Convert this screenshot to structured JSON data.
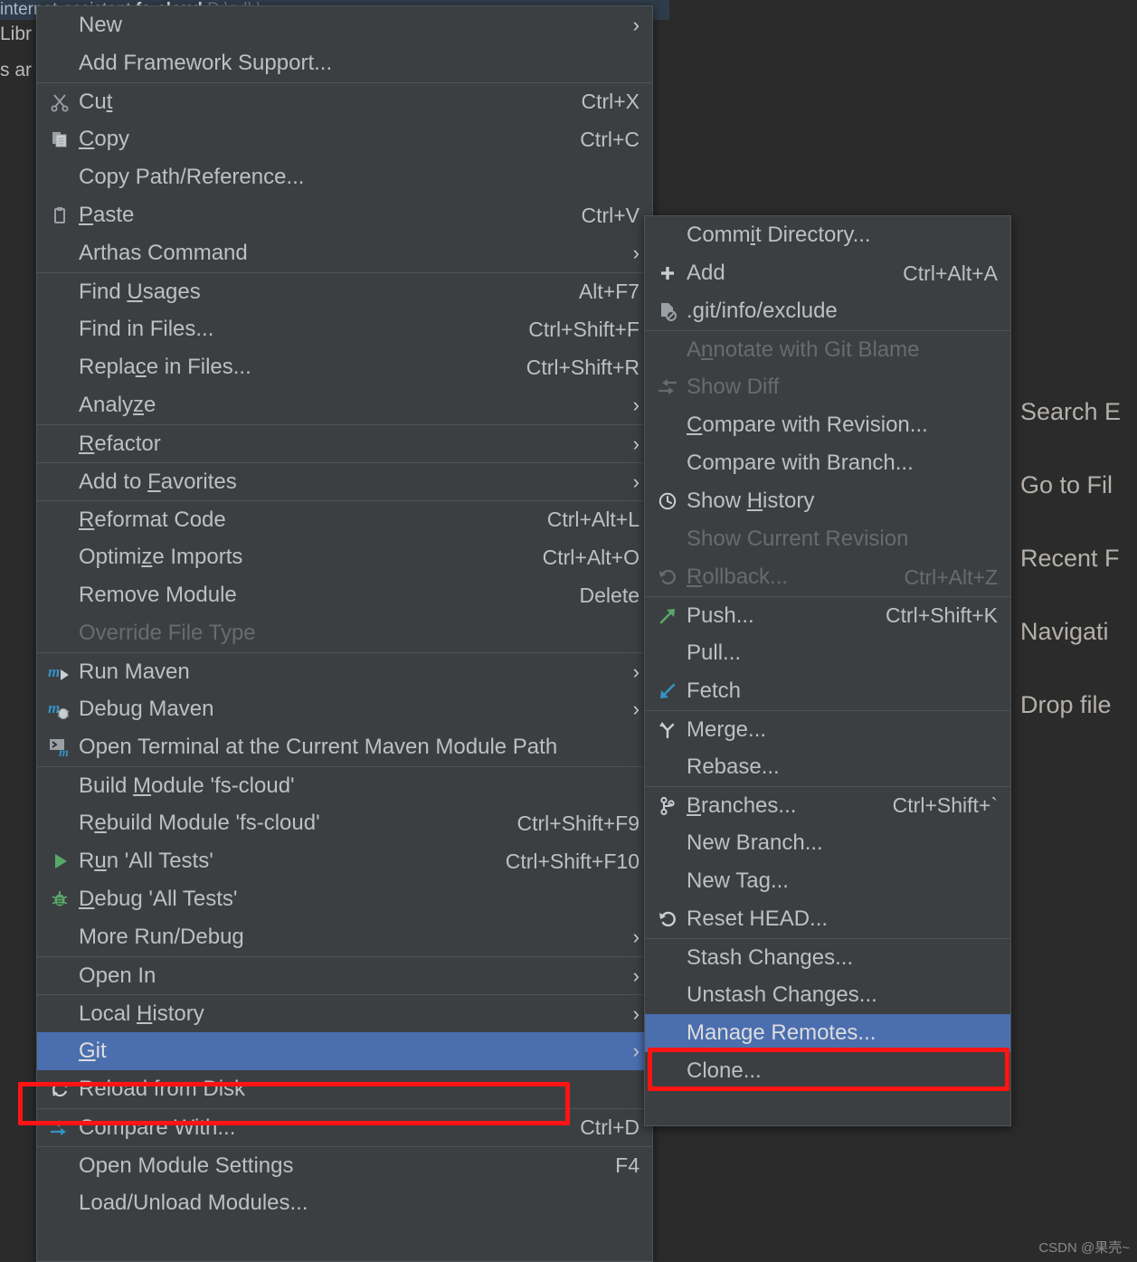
{
  "background": {
    "project_tree_row": {
      "project": "internet-assistant",
      "module": "fs-cloud",
      "path": "D:\\zdh\\"
    },
    "tree_lines": [
      "Libr",
      "s ar"
    ],
    "editor_hints": [
      "Search E",
      "Go to Fil",
      "Recent F",
      "Navigati",
      "Drop file"
    ],
    "watermark": "CSDN @果壳~",
    "colors": {
      "editor_bg": "#2b2b2b",
      "menu_bg": "#3c3f41",
      "menu_border": "#4f5355",
      "selection": "#4b6eaf",
      "text": "#bfbfbf",
      "disabled_text": "#6a6a6a",
      "annotation": "#ff1414"
    }
  },
  "context_menu": {
    "name": "module-context-menu",
    "items": [
      {
        "label": "New",
        "mnemonic": "",
        "shortcut": "",
        "icon": "",
        "arrow": true,
        "separator": false,
        "disabled": false,
        "selected": false
      },
      {
        "label": "Add Framework Support...",
        "mnemonic": "",
        "shortcut": "",
        "icon": "",
        "arrow": false,
        "separator": false,
        "disabled": false,
        "selected": false
      },
      {
        "label": "Cut",
        "mnemonic": "t",
        "shortcut": "Ctrl+X",
        "icon": "scissors-icon",
        "arrow": false,
        "separator": true,
        "disabled": false,
        "selected": false
      },
      {
        "label": "Copy",
        "mnemonic": "C",
        "shortcut": "Ctrl+C",
        "icon": "copy-icon",
        "arrow": false,
        "separator": false,
        "disabled": false,
        "selected": false
      },
      {
        "label": "Copy Path/Reference...",
        "mnemonic": "",
        "shortcut": "",
        "icon": "",
        "arrow": false,
        "separator": false,
        "disabled": false,
        "selected": false
      },
      {
        "label": "Paste",
        "mnemonic": "P",
        "shortcut": "Ctrl+V",
        "icon": "clipboard-icon",
        "arrow": false,
        "separator": false,
        "disabled": false,
        "selected": false
      },
      {
        "label": "Arthas Command",
        "mnemonic": "",
        "shortcut": "",
        "icon": "",
        "arrow": true,
        "separator": false,
        "disabled": false,
        "selected": false
      },
      {
        "label": "Find Usages",
        "mnemonic": "U",
        "shortcut": "Alt+F7",
        "icon": "",
        "arrow": false,
        "separator": true,
        "disabled": false,
        "selected": false
      },
      {
        "label": "Find in Files...",
        "mnemonic": "",
        "shortcut": "Ctrl+Shift+F",
        "icon": "",
        "arrow": false,
        "separator": false,
        "disabled": false,
        "selected": false
      },
      {
        "label": "Replace in Files...",
        "mnemonic": "c",
        "shortcut": "Ctrl+Shift+R",
        "icon": "",
        "arrow": false,
        "separator": false,
        "disabled": false,
        "selected": false
      },
      {
        "label": "Analyze",
        "mnemonic": "z",
        "shortcut": "",
        "icon": "",
        "arrow": true,
        "separator": false,
        "disabled": false,
        "selected": false
      },
      {
        "label": "Refactor",
        "mnemonic": "R",
        "shortcut": "",
        "icon": "",
        "arrow": true,
        "separator": true,
        "disabled": false,
        "selected": false
      },
      {
        "label": "Add to Favorites",
        "mnemonic": "F",
        "shortcut": "",
        "icon": "",
        "arrow": true,
        "separator": true,
        "disabled": false,
        "selected": false
      },
      {
        "label": "Reformat Code",
        "mnemonic": "R",
        "shortcut": "Ctrl+Alt+L",
        "icon": "",
        "arrow": false,
        "separator": true,
        "disabled": false,
        "selected": false
      },
      {
        "label": "Optimize Imports",
        "mnemonic": "z",
        "shortcut": "Ctrl+Alt+O",
        "icon": "",
        "arrow": false,
        "separator": false,
        "disabled": false,
        "selected": false
      },
      {
        "label": "Remove Module",
        "mnemonic": "",
        "shortcut": "Delete",
        "icon": "",
        "arrow": false,
        "separator": false,
        "disabled": false,
        "selected": false
      },
      {
        "label": "Override File Type",
        "mnemonic": "",
        "shortcut": "",
        "icon": "",
        "arrow": false,
        "separator": false,
        "disabled": true,
        "selected": false
      },
      {
        "label": "Run Maven",
        "mnemonic": "",
        "shortcut": "",
        "icon": "maven-run-icon",
        "arrow": true,
        "separator": true,
        "disabled": false,
        "selected": false
      },
      {
        "label": "Debug Maven",
        "mnemonic": "",
        "shortcut": "",
        "icon": "maven-debug-icon",
        "arrow": true,
        "separator": false,
        "disabled": false,
        "selected": false
      },
      {
        "label": "Open Terminal at the Current Maven Module Path",
        "mnemonic": "",
        "shortcut": "",
        "icon": "maven-terminal-icon",
        "arrow": false,
        "separator": false,
        "disabled": false,
        "selected": false
      },
      {
        "label": "Build Module 'fs-cloud'",
        "mnemonic": "M",
        "shortcut": "",
        "icon": "",
        "arrow": false,
        "separator": true,
        "disabled": false,
        "selected": false
      },
      {
        "label": "Rebuild Module 'fs-cloud'",
        "mnemonic": "e",
        "shortcut": "Ctrl+Shift+F9",
        "icon": "",
        "arrow": false,
        "separator": false,
        "disabled": false,
        "selected": false
      },
      {
        "label": "Run 'All Tests'",
        "mnemonic": "u",
        "shortcut": "Ctrl+Shift+F10",
        "icon": "run-icon",
        "arrow": false,
        "separator": false,
        "disabled": false,
        "selected": false
      },
      {
        "label": "Debug 'All Tests'",
        "mnemonic": "D",
        "shortcut": "",
        "icon": "debug-icon",
        "arrow": false,
        "separator": false,
        "disabled": false,
        "selected": false
      },
      {
        "label": "More Run/Debug",
        "mnemonic": "",
        "shortcut": "",
        "icon": "",
        "arrow": true,
        "separator": false,
        "disabled": false,
        "selected": false
      },
      {
        "label": "Open In",
        "mnemonic": "",
        "shortcut": "",
        "icon": "",
        "arrow": true,
        "separator": true,
        "disabled": false,
        "selected": false
      },
      {
        "label": "Local History",
        "mnemonic": "H",
        "shortcut": "",
        "icon": "",
        "arrow": true,
        "separator": true,
        "disabled": false,
        "selected": false
      },
      {
        "label": "Git",
        "mnemonic": "G",
        "shortcut": "",
        "icon": "",
        "arrow": true,
        "separator": false,
        "disabled": false,
        "selected": true
      },
      {
        "label": "Reload from Disk",
        "mnemonic": "",
        "shortcut": "",
        "icon": "reload-icon",
        "arrow": false,
        "separator": false,
        "disabled": false,
        "selected": false
      },
      {
        "label": "Compare With...",
        "mnemonic": "",
        "shortcut": "Ctrl+D",
        "icon": "compare-icon",
        "arrow": false,
        "separator": true,
        "disabled": false,
        "selected": false
      },
      {
        "label": "Open Module Settings",
        "mnemonic": "",
        "shortcut": "F4",
        "icon": "",
        "arrow": false,
        "separator": true,
        "disabled": false,
        "selected": false
      },
      {
        "label": "Load/Unload Modules...",
        "mnemonic": "",
        "shortcut": "",
        "icon": "",
        "arrow": false,
        "separator": false,
        "disabled": false,
        "selected": false
      }
    ]
  },
  "git_submenu": {
    "name": "git-submenu",
    "items": [
      {
        "label": "Commit Directory...",
        "mnemonic": "i",
        "shortcut": "",
        "icon": "",
        "arrow": false,
        "separator": false,
        "disabled": false,
        "selected": false
      },
      {
        "label": "Add",
        "mnemonic": "",
        "shortcut": "Ctrl+Alt+A",
        "icon": "plus-icon",
        "arrow": false,
        "separator": false,
        "disabled": false,
        "selected": false
      },
      {
        "label": ".git/info/exclude",
        "mnemonic": "",
        "shortcut": "",
        "icon": "file-exclude-icon",
        "arrow": false,
        "separator": false,
        "disabled": false,
        "selected": false
      },
      {
        "label": "Annotate with Git Blame",
        "mnemonic": "n",
        "shortcut": "",
        "icon": "",
        "arrow": false,
        "separator": true,
        "disabled": true,
        "selected": false
      },
      {
        "label": "Show Diff",
        "mnemonic": "",
        "shortcut": "",
        "icon": "diff-icon",
        "arrow": false,
        "separator": false,
        "disabled": true,
        "selected": false
      },
      {
        "label": "Compare with Revision...",
        "mnemonic": "C",
        "shortcut": "",
        "icon": "",
        "arrow": false,
        "separator": false,
        "disabled": false,
        "selected": false
      },
      {
        "label": "Compare with Branch...",
        "mnemonic": "",
        "shortcut": "",
        "icon": "",
        "arrow": false,
        "separator": false,
        "disabled": false,
        "selected": false
      },
      {
        "label": "Show History",
        "mnemonic": "H",
        "shortcut": "",
        "icon": "history-icon",
        "arrow": false,
        "separator": false,
        "disabled": false,
        "selected": false
      },
      {
        "label": "Show Current Revision",
        "mnemonic": "",
        "shortcut": "",
        "icon": "",
        "arrow": false,
        "separator": false,
        "disabled": true,
        "selected": false
      },
      {
        "label": "Rollback...",
        "mnemonic": "R",
        "shortcut": "Ctrl+Alt+Z",
        "icon": "rollback-icon",
        "arrow": false,
        "separator": false,
        "disabled": true,
        "selected": false
      },
      {
        "label": "Push...",
        "mnemonic": "",
        "shortcut": "Ctrl+Shift+K",
        "icon": "push-icon",
        "arrow": false,
        "separator": true,
        "disabled": false,
        "selected": false
      },
      {
        "label": "Pull...",
        "mnemonic": "",
        "shortcut": "",
        "icon": "",
        "arrow": false,
        "separator": false,
        "disabled": false,
        "selected": false
      },
      {
        "label": "Fetch",
        "mnemonic": "",
        "shortcut": "",
        "icon": "fetch-icon",
        "arrow": false,
        "separator": false,
        "disabled": false,
        "selected": false
      },
      {
        "label": "Merge...",
        "mnemonic": "",
        "shortcut": "",
        "icon": "merge-icon",
        "arrow": false,
        "separator": true,
        "disabled": false,
        "selected": false
      },
      {
        "label": "Rebase...",
        "mnemonic": "",
        "shortcut": "",
        "icon": "",
        "arrow": false,
        "separator": false,
        "disabled": false,
        "selected": false
      },
      {
        "label": "Branches...",
        "mnemonic": "B",
        "shortcut": "Ctrl+Shift+`",
        "icon": "branch-icon",
        "arrow": false,
        "separator": true,
        "disabled": false,
        "selected": false
      },
      {
        "label": "New Branch...",
        "mnemonic": "",
        "shortcut": "",
        "icon": "",
        "arrow": false,
        "separator": false,
        "disabled": false,
        "selected": false
      },
      {
        "label": "New Tag...",
        "mnemonic": "",
        "shortcut": "",
        "icon": "",
        "arrow": false,
        "separator": false,
        "disabled": false,
        "selected": false
      },
      {
        "label": "Reset HEAD...",
        "mnemonic": "",
        "shortcut": "",
        "icon": "reset-icon",
        "arrow": false,
        "separator": false,
        "disabled": false,
        "selected": false
      },
      {
        "label": "Stash Changes...",
        "mnemonic": "",
        "shortcut": "",
        "icon": "",
        "arrow": false,
        "separator": true,
        "disabled": false,
        "selected": false
      },
      {
        "label": "Unstash Changes...",
        "mnemonic": "",
        "shortcut": "",
        "icon": "",
        "arrow": false,
        "separator": false,
        "disabled": false,
        "selected": false
      },
      {
        "label": "Manage Remotes...",
        "mnemonic": "",
        "shortcut": "",
        "icon": "",
        "arrow": false,
        "separator": false,
        "disabled": false,
        "selected": true
      },
      {
        "label": "Clone...",
        "mnemonic": "",
        "shortcut": "",
        "icon": "",
        "arrow": false,
        "separator": false,
        "disabled": false,
        "selected": false
      }
    ]
  },
  "annotations": [
    {
      "name": "git-highlight-box",
      "target": "Git"
    },
    {
      "name": "manage-remotes-highlight-box",
      "target": "Manage Remotes..."
    }
  ]
}
